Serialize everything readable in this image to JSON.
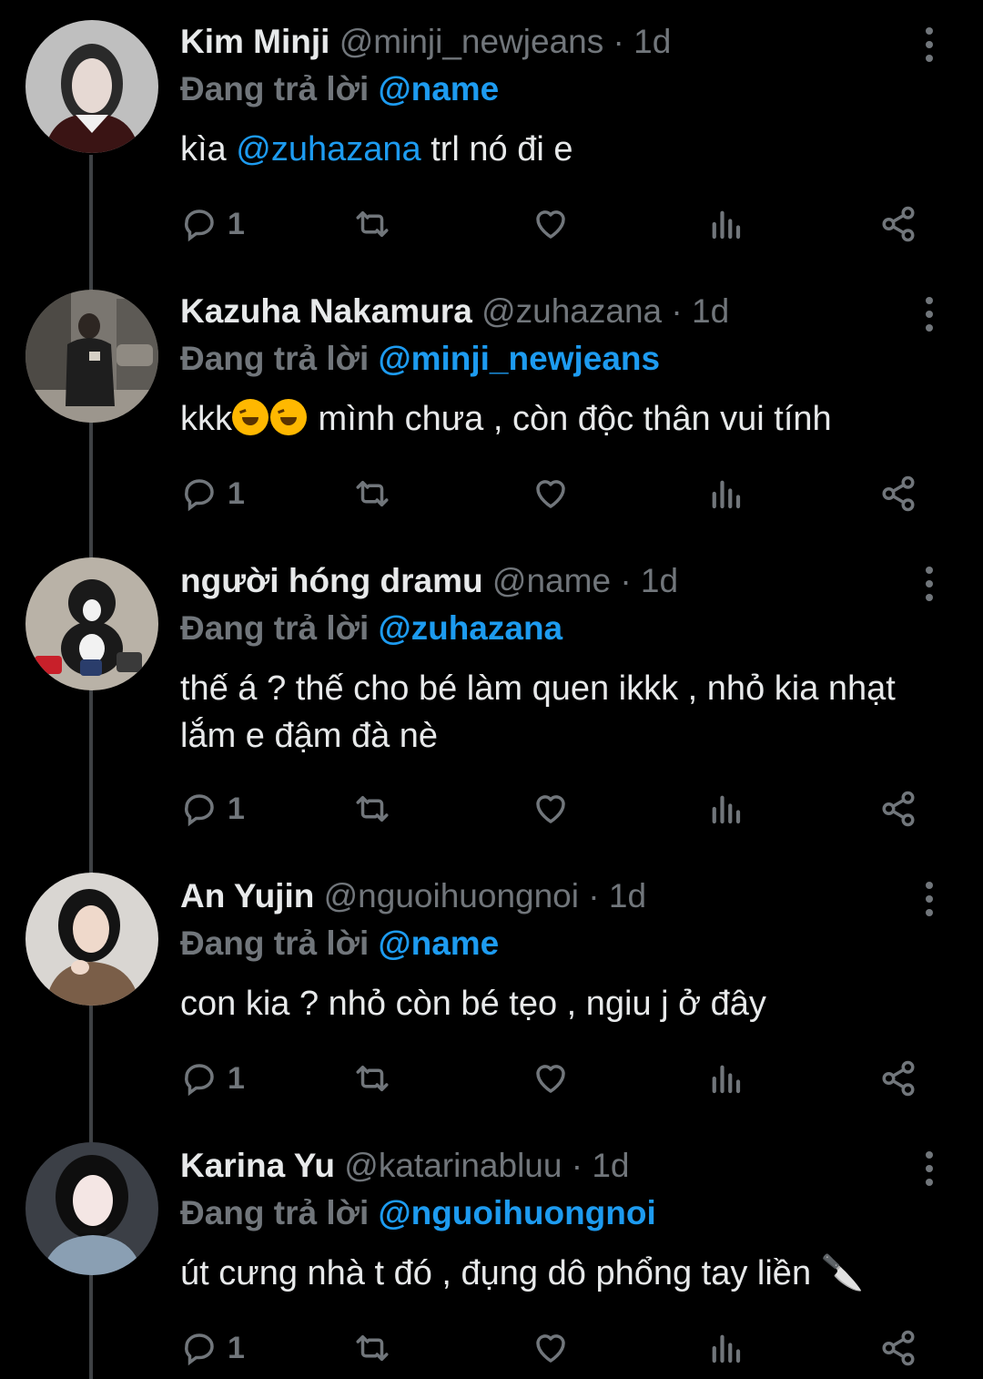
{
  "thread": {
    "reply_prefix": "Đang trả lời",
    "tweets": [
      {
        "name": "Kim Minji",
        "handle": "@minji_newjeans",
        "separator": "·",
        "time": "1d",
        "reply_to": "@name",
        "text_parts": [
          "kìa ",
          "@zuhazana",
          " trl nó đi e"
        ],
        "reply_count": "1"
      },
      {
        "name": "Kazuha Nakamura",
        "handle": "@zuhazana",
        "separator": "·",
        "time": "1d",
        "reply_to": "@minji_newjeans",
        "text_prefix": "kkk",
        "text_emoji": "rolling-on-floor-laughing-emoji x2",
        "text": " mình chưa , còn độc thân vui tính",
        "reply_count": "1"
      },
      {
        "name": "người hóng dramu",
        "handle": "@name",
        "separator": "·",
        "time": "1d",
        "reply_to": "@zuhazana",
        "text": "thế á ? thế cho bé làm quen ikkk , nhỏ kia nhạt lắm e đậm đà nè",
        "reply_count": "1"
      },
      {
        "name": "An Yujin",
        "handle": "@nguoihuongnoi",
        "separator": "·",
        "time": "1d",
        "reply_to": "@name",
        "text": "con kia ? nhỏ còn bé tẹo , ngiu j ở đây",
        "reply_count": "1"
      },
      {
        "name": "Karina Yu",
        "handle": "@katarinabluu",
        "separator": "·",
        "time": "1d",
        "reply_to": "@nguoihuongnoi",
        "text": "út cưng nhà t đó , đụng dô phổng tay liền 🔪",
        "reply_count": "1"
      }
    ]
  },
  "icons": {
    "reply": "reply-icon",
    "retweet": "retweet-icon",
    "like": "heart-icon",
    "views": "views-icon",
    "share": "share-icon",
    "more": "more-vertical-icon"
  },
  "colors": {
    "background": "#000000",
    "primary_text": "#e7e9ea",
    "secondary_text": "#71767b",
    "accent": "#1d9bf0",
    "thread_line": "#3e4144"
  }
}
